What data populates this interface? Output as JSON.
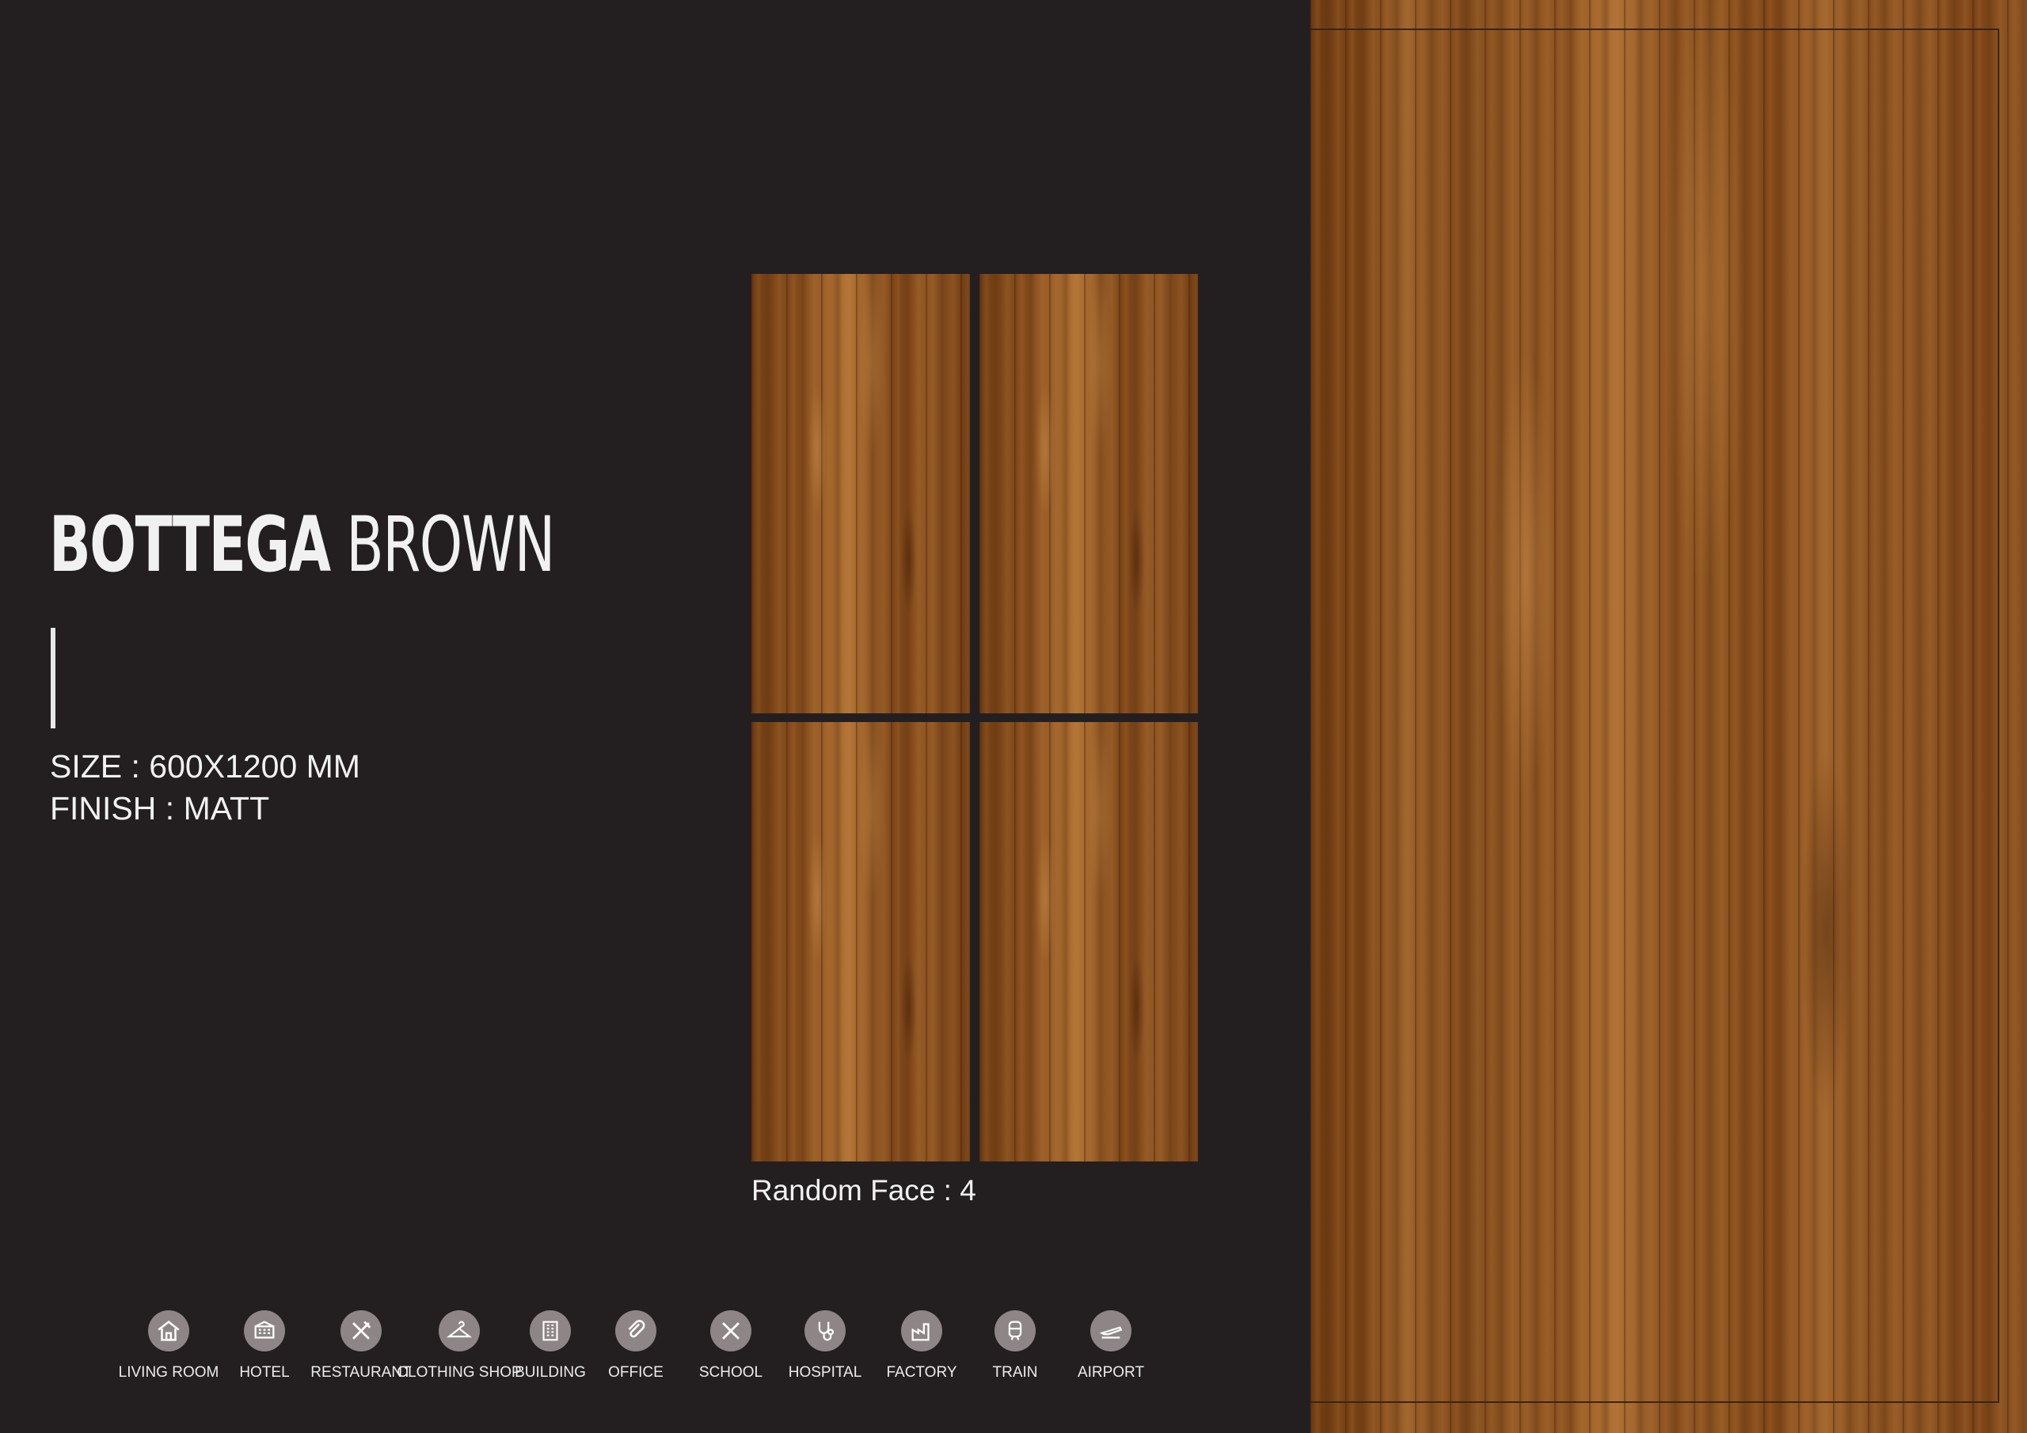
{
  "product": {
    "title_bold": "BOTTEGA",
    "title_light": "BROWN",
    "size": "SIZE : 600X1200 MM",
    "finish": "FINISH : MATT",
    "random_face": "Random Face : 4"
  },
  "applications": [
    {
      "label": "LIVING ROOM",
      "icon": "house-icon"
    },
    {
      "label": "HOTEL",
      "icon": "hotel-icon"
    },
    {
      "label": "RESTAURANT",
      "icon": "fork-knife-icon"
    },
    {
      "label": "CLOTHING SHOP",
      "icon": "hanger-icon"
    },
    {
      "label": "BUILDING",
      "icon": "building-icon"
    },
    {
      "label": "OFFICE",
      "icon": "paperclip-icon"
    },
    {
      "label": "SCHOOL",
      "icon": "pencil-ruler-icon"
    },
    {
      "label": "HOSPITAL",
      "icon": "stethoscope-icon"
    },
    {
      "label": "FACTORY",
      "icon": "factory-icon"
    },
    {
      "label": "TRAIN",
      "icon": "train-icon"
    },
    {
      "label": "AIRPORT",
      "icon": "plane-icon"
    }
  ],
  "colors": {
    "background": "#231f20",
    "text": "#f1f1f1",
    "icon_circle": "#8e8686",
    "wood": "#8a5120"
  }
}
